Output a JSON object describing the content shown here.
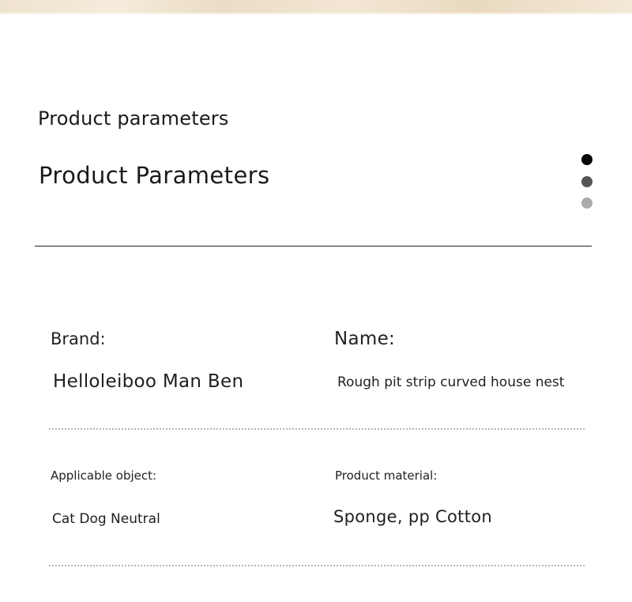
{
  "header": {
    "subtitle": "Product parameters",
    "title": "Product Parameters"
  },
  "pagination": {
    "dot_colors": [
      "#050505",
      "#555555",
      "#aaaaaa"
    ]
  },
  "params": {
    "brand_label": "Brand:",
    "brand_value": "Helloleiboo Man Ben",
    "name_label": "Name:",
    "name_value": "Rough pit strip curved house nest",
    "applicable_label": "Applicable object:",
    "applicable_value": "Cat Dog Neutral",
    "material_label": "Product material:",
    "material_value": "Sponge, pp Cotton"
  }
}
